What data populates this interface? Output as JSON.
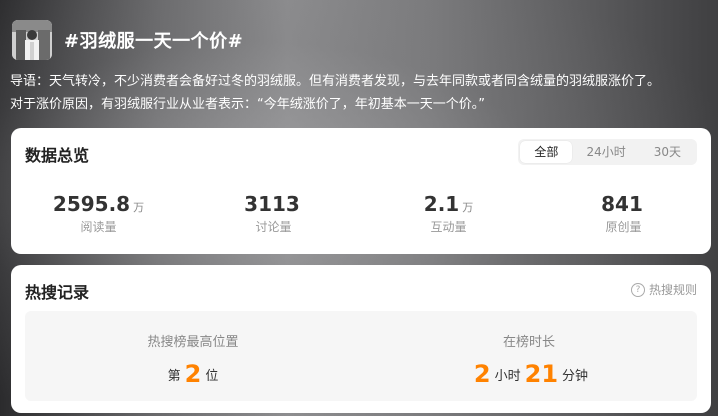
{
  "header": {
    "title": "#羽绒服一天一个价#",
    "avatar_icon": "topic-avatar-image"
  },
  "intro": {
    "line1": "导语：天气转冷，不少消费者会备好过冬的羽绒服。但有消费者发现，与去年同款或者同含绒量的羽绒服涨价了。",
    "line2": "对于涨价原因，有羽绒服行业从业者表示：“今年绒涨价了，年初基本一天一个价。”"
  },
  "overview": {
    "title": "数据总览",
    "tabs": [
      {
        "label": "全部",
        "active": true
      },
      {
        "label": "24小时",
        "active": false
      },
      {
        "label": "30天",
        "active": false
      }
    ],
    "stats": [
      {
        "value": "2595.8",
        "unit": "万",
        "label": "阅读量"
      },
      {
        "value": "3113",
        "unit": "",
        "label": "讨论量"
      },
      {
        "value": "2.1",
        "unit": "万",
        "label": "互动量"
      },
      {
        "value": "841",
        "unit": "",
        "label": "原创量"
      }
    ]
  },
  "hot_record": {
    "title": "热搜记录",
    "rule_link": "热搜规则",
    "help_icon": "question-circle-icon",
    "peak": {
      "label": "热搜榜最高位置",
      "prefix": "第",
      "value": "2",
      "suffix": "位"
    },
    "duration": {
      "label": "在榜时长",
      "hours": "2",
      "hours_unit": "小时",
      "minutes": "21",
      "minutes_unit": "分钟"
    }
  },
  "colors": {
    "accent": "#ff8200",
    "card_bg": "#ffffff",
    "record_bg": "#f6f6f6"
  }
}
